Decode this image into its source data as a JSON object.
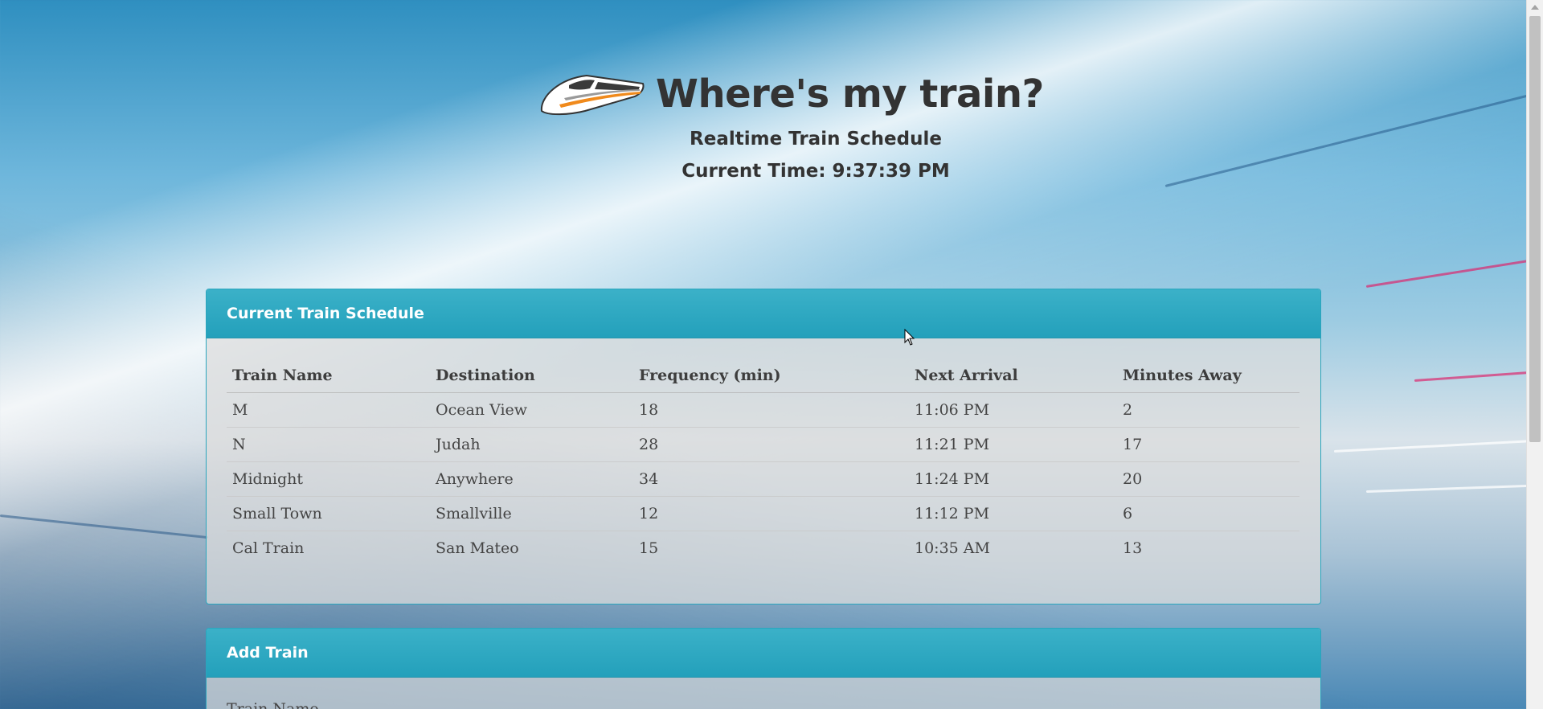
{
  "header": {
    "title": "Where's my train?",
    "subtitle": "Realtime Train Schedule",
    "current_time": "Current Time: 9:37:39 PM",
    "logo_icon": "train-icon"
  },
  "schedule": {
    "heading": "Current Train Schedule",
    "columns": [
      "Train Name",
      "Destination",
      "Frequency (min)",
      "Next Arrival",
      "Minutes Away"
    ],
    "rows": [
      [
        "M",
        "Ocean View",
        "18",
        "11:06 PM",
        "2"
      ],
      [
        "N",
        "Judah",
        "28",
        "11:21 PM",
        "17"
      ],
      [
        "Midnight",
        "Anywhere",
        "34",
        "11:24 PM",
        "20"
      ],
      [
        "Small Town",
        "Smallville",
        "12",
        "11:12 PM",
        "6"
      ],
      [
        "Cal Train",
        "San Mateo",
        "15",
        "10:35 AM",
        "13"
      ]
    ]
  },
  "add_train": {
    "heading": "Add Train",
    "train_name_label": "Train Name"
  },
  "colors": {
    "panel_header": "#23a0bb",
    "text": "#333333"
  }
}
